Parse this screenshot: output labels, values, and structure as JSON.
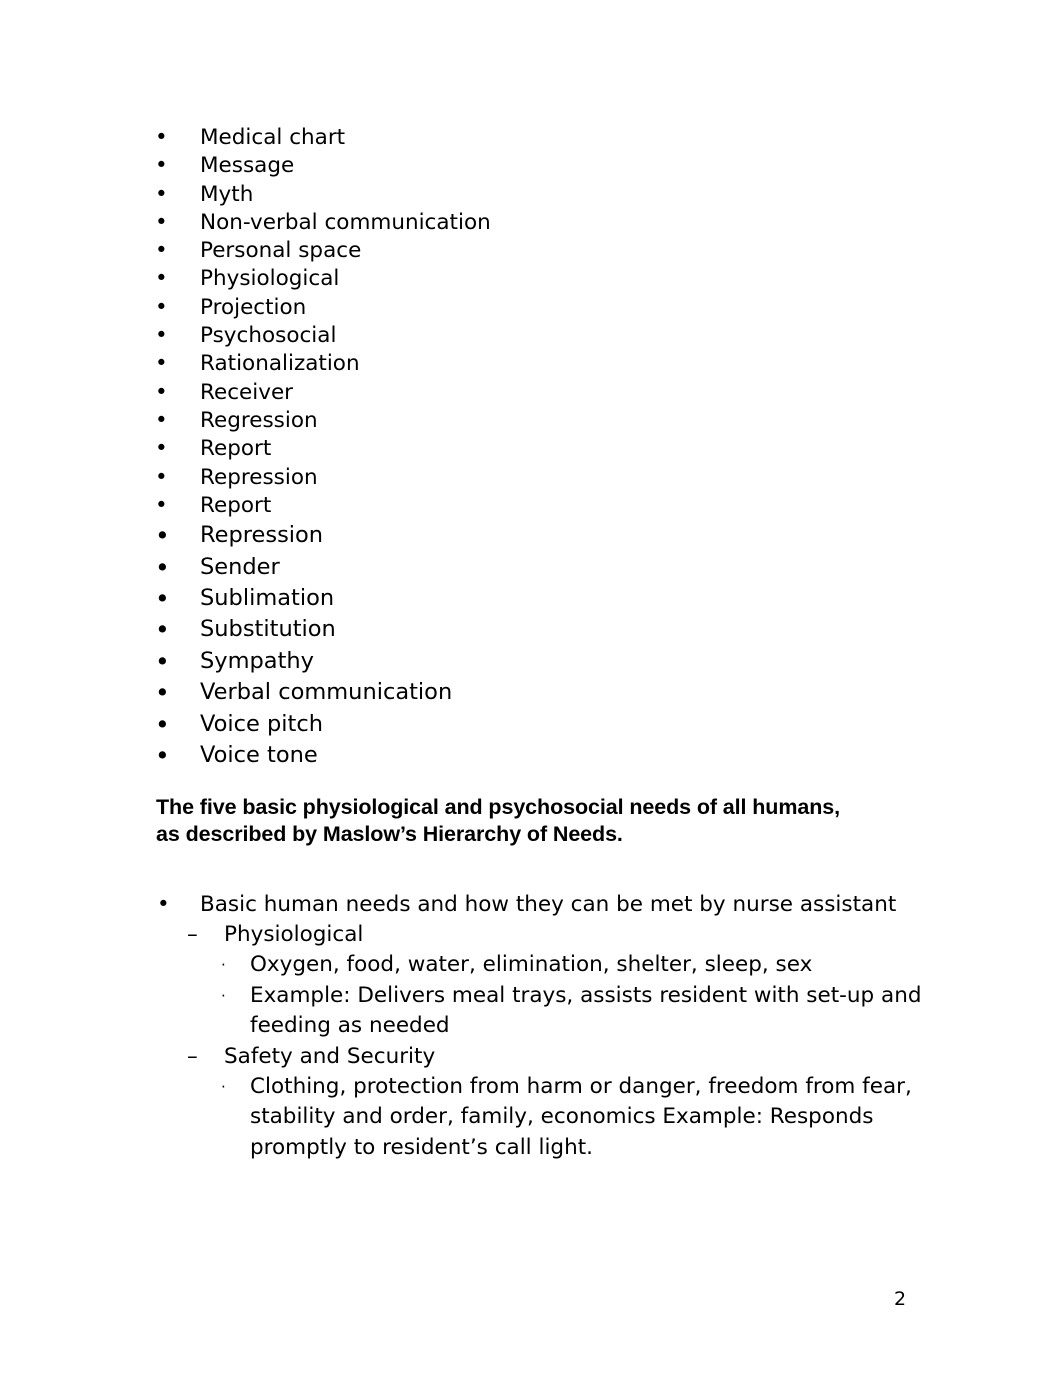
{
  "document": {
    "glossary": {
      "items": [
        {
          "bullet": "•",
          "label": "Medical chart"
        },
        {
          "bullet": "•",
          "label": "Message"
        },
        {
          "bullet": "•",
          "label": "Myth"
        },
        {
          "bullet": "•",
          "label": "Non-verbal communication"
        },
        {
          "bullet": "•",
          "label": "Personal space"
        },
        {
          "bullet": "•",
          "label": "Physiological"
        },
        {
          "bullet": "•",
          "label": "Projection"
        },
        {
          "bullet": "•",
          "label": "Psychosocial"
        },
        {
          "bullet": "•",
          "label": "Rationalization"
        },
        {
          "bullet": "•",
          "label": "Receiver"
        },
        {
          "bullet": "•",
          "label": "Regression"
        },
        {
          "bullet": "•",
          "label": "Report"
        },
        {
          "bullet": "•",
          "label": "Repression"
        },
        {
          "bullet": "•",
          "label": "Report"
        },
        {
          "bullet": "•",
          "label": "Repression"
        },
        {
          "bullet": "•",
          "label": "Sender"
        },
        {
          "bullet": "•",
          "label": "Sublimation"
        },
        {
          "bullet": "•",
          "label": "Substitution"
        },
        {
          "bullet": "•",
          "label": "Sympathy"
        },
        {
          "bullet": "•",
          "label": "Verbal communication"
        },
        {
          "bullet": "•",
          "label": "Voice pitch"
        },
        {
          "bullet": "•",
          "label": "Voice tone"
        }
      ]
    },
    "heading": {
      "text": "The five basic physiological and psychosocial needs of all humans, as described by Maslow’s Hierarchy of Needs."
    },
    "outline": {
      "level1": {
        "bullet": "•",
        "text": "Basic human needs and how they can be met by nurse assistant"
      },
      "groups": [
        {
          "dash": "–",
          "title": "Physiological",
          "points": [
            {
              "bullet": "·",
              "text": "Oxygen, food, water, elimination, shelter, sleep, sex"
            },
            {
              "bullet": "·",
              "text": "Example: Delivers meal trays, assists resident with set-up and feeding as needed"
            }
          ]
        },
        {
          "dash": "–",
          "title": "Safety and Security",
          "points": [
            {
              "bullet": "·",
              "text": "Clothing, protection from harm or danger, freedom from fear, stability and order, family, economics  Example: Responds promptly to resident’s call light."
            }
          ]
        }
      ]
    },
    "page_number": "2"
  }
}
